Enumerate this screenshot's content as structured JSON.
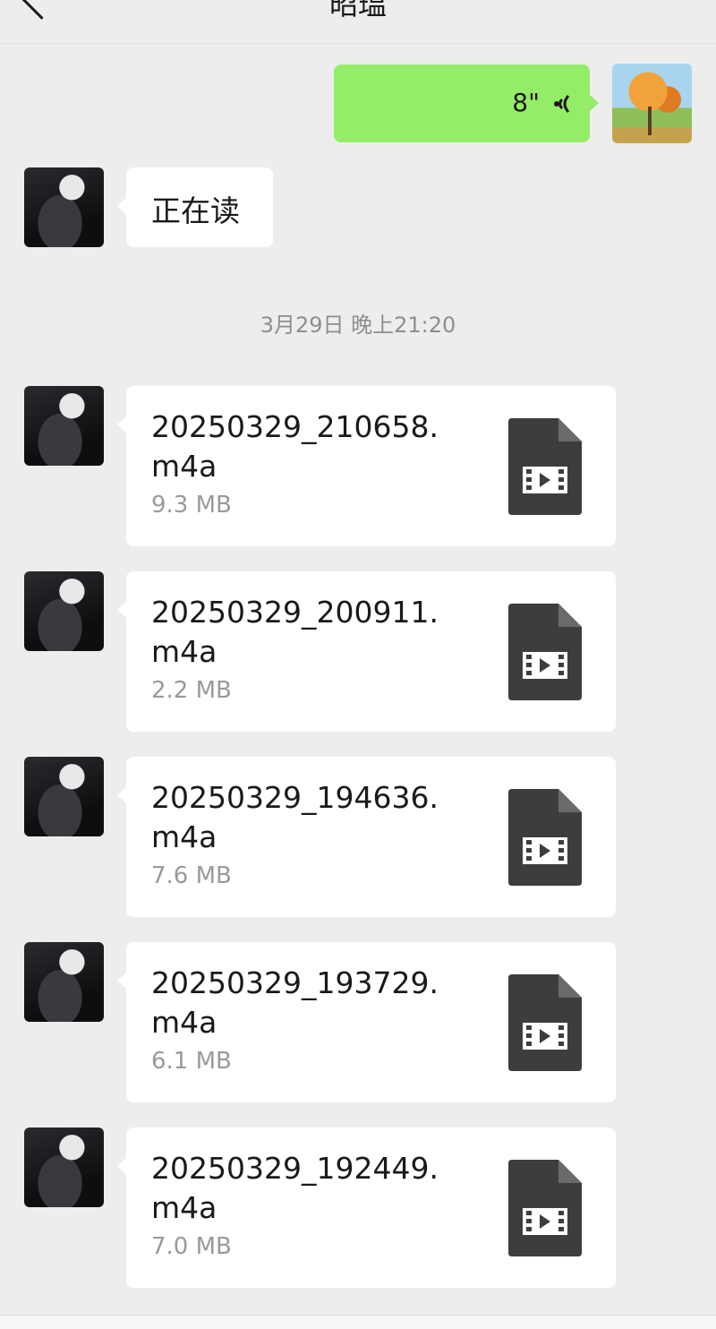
{
  "header": {
    "title": "昭瑥"
  },
  "messages": {
    "voice": {
      "duration": "8\""
    },
    "text1": {
      "text": "正在读"
    },
    "timestamp": "3月29日 晚上21:20",
    "files": [
      {
        "name": "20250329_210658.m4a",
        "size": "9.3 MB"
      },
      {
        "name": "20250329_200911.m4a",
        "size": "2.2 MB"
      },
      {
        "name": "20250329_194636.m4a",
        "size": "7.6 MB"
      },
      {
        "name": "20250329_193729.m4a",
        "size": "6.1 MB"
      },
      {
        "name": "20250329_192449.m4a",
        "size": "7.0 MB"
      }
    ]
  },
  "icons": {
    "back": "back-arrow-icon",
    "voice": "voice-wave-icon",
    "file": "video-file-icon"
  },
  "colors": {
    "self_bubble": "#95ec69",
    "other_bubble": "#ffffff",
    "background": "#ededed",
    "file_icon": "#3d3d3d"
  }
}
